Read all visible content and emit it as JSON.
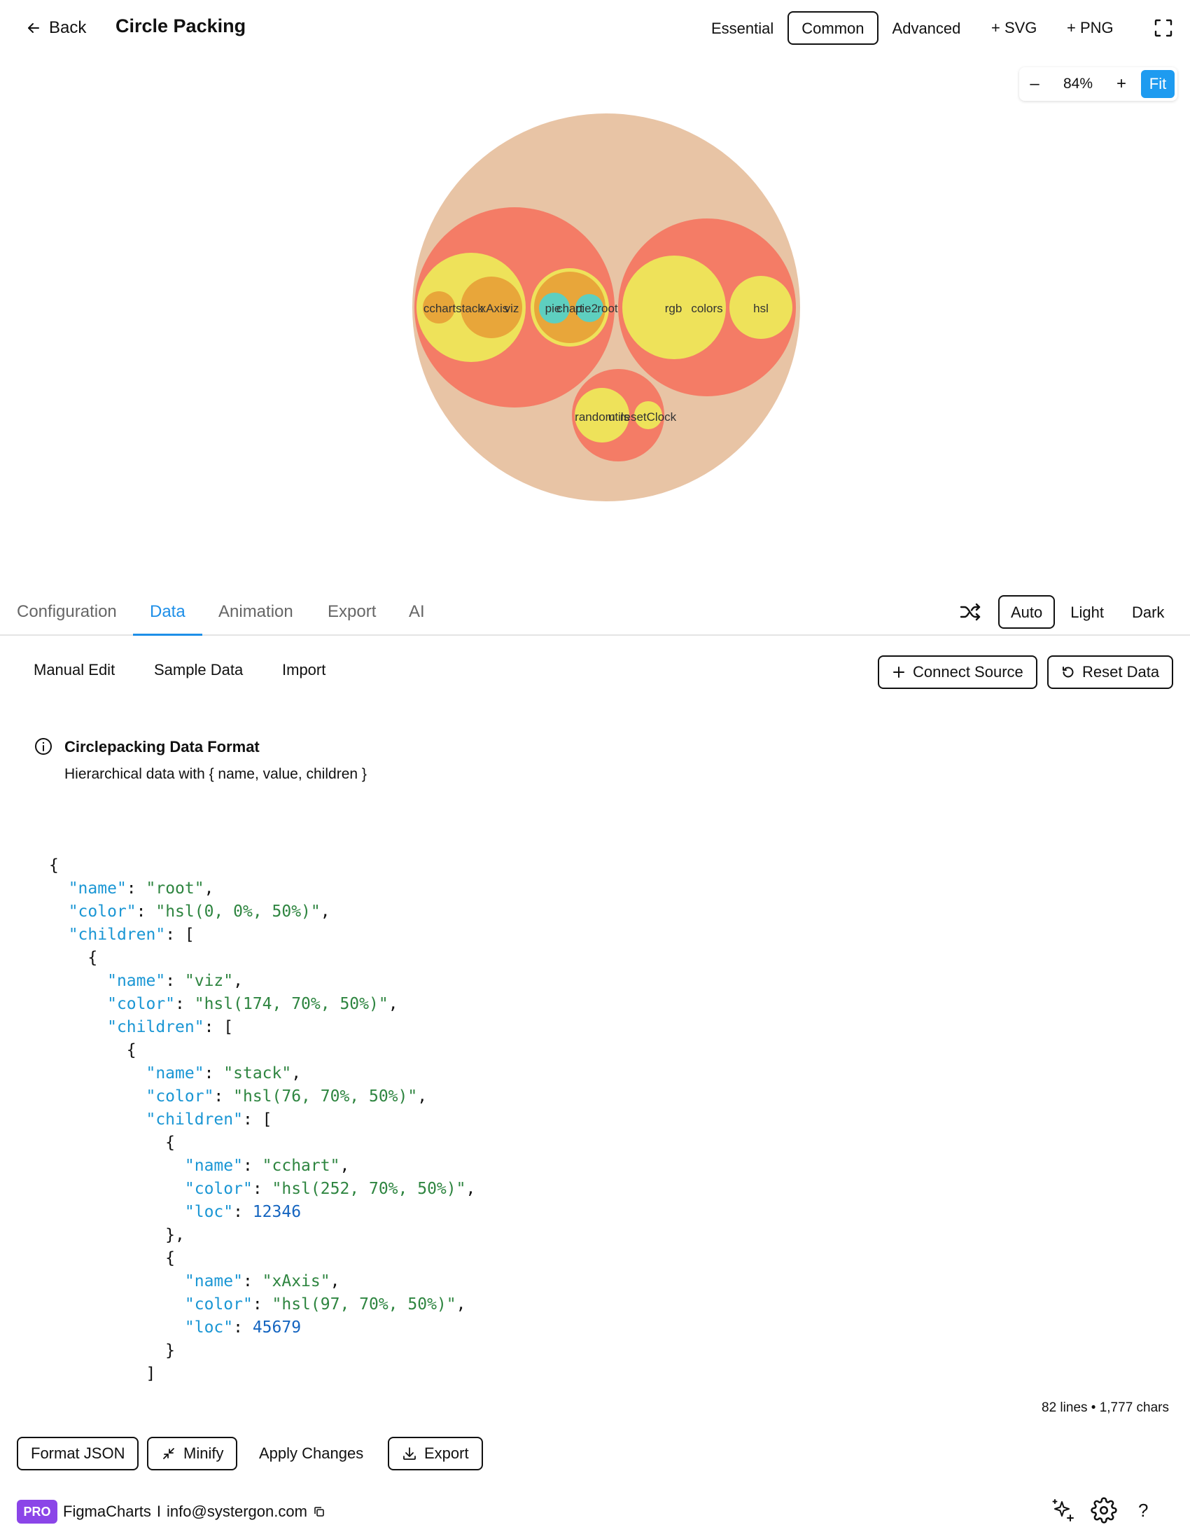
{
  "header": {
    "back_label": "Back",
    "title": "Circle Packing",
    "modes": [
      "Essential",
      "Common",
      "Advanced"
    ],
    "active_mode": "Common",
    "add_svg_label": "+ SVG",
    "add_png_label": "+ PNG"
  },
  "zoom": {
    "minus": "–",
    "value": "84%",
    "plus": "+",
    "fit_label": "Fit",
    "fit_color": "#1e9bf0"
  },
  "chart_data": {
    "type": "circle-packing",
    "colors": {
      "root": "#e8c4a5",
      "group": "#f47c66",
      "leaf": "#eee25a",
      "inner": "#e8a63a",
      "accent": "#5ecfbf"
    },
    "labels": [
      "cchart",
      "stack",
      "xAxis",
      "viz",
      "pie",
      "chart",
      "pie2",
      "root",
      "rgb",
      "colors",
      "hsl",
      "random",
      "utils",
      "resetClock"
    ]
  },
  "tabs": {
    "items": [
      "Configuration",
      "Data",
      "Animation",
      "Export",
      "AI"
    ],
    "active": "Data"
  },
  "theme": {
    "options": [
      "Auto",
      "Light",
      "Dark"
    ],
    "active": "Auto"
  },
  "subtabs": {
    "items": [
      "Manual Edit",
      "Sample Data",
      "Import"
    ]
  },
  "actions": {
    "connect_source": "Connect Source",
    "reset_data": "Reset Data"
  },
  "info": {
    "title": "Circlepacking Data Format",
    "description": "Hierarchical data with { name, value, children }"
  },
  "editor": {
    "lines": [
      [
        [
          "pun",
          "{"
        ]
      ],
      [
        [
          "pun",
          "  "
        ],
        [
          "key",
          "\"name\""
        ],
        [
          "pun",
          ": "
        ],
        [
          "str",
          "\"root\""
        ],
        [
          "pun",
          ","
        ]
      ],
      [
        [
          "pun",
          "  "
        ],
        [
          "key",
          "\"color\""
        ],
        [
          "pun",
          ": "
        ],
        [
          "str",
          "\"hsl(0, 0%, 50%)\""
        ],
        [
          "pun",
          ","
        ]
      ],
      [
        [
          "pun",
          "  "
        ],
        [
          "key",
          "\"children\""
        ],
        [
          "pun",
          ": ["
        ]
      ],
      [
        [
          "pun",
          "    {"
        ]
      ],
      [
        [
          "pun",
          "      "
        ],
        [
          "key",
          "\"name\""
        ],
        [
          "pun",
          ": "
        ],
        [
          "str",
          "\"viz\""
        ],
        [
          "pun",
          ","
        ]
      ],
      [
        [
          "pun",
          "      "
        ],
        [
          "key",
          "\"color\""
        ],
        [
          "pun",
          ": "
        ],
        [
          "str",
          "\"hsl(174, 70%, 50%)\""
        ],
        [
          "pun",
          ","
        ]
      ],
      [
        [
          "pun",
          "      "
        ],
        [
          "key",
          "\"children\""
        ],
        [
          "pun",
          ": ["
        ]
      ],
      [
        [
          "pun",
          "        {"
        ]
      ],
      [
        [
          "pun",
          "          "
        ],
        [
          "key",
          "\"name\""
        ],
        [
          "pun",
          ": "
        ],
        [
          "str",
          "\"stack\""
        ],
        [
          "pun",
          ","
        ]
      ],
      [
        [
          "pun",
          "          "
        ],
        [
          "key",
          "\"color\""
        ],
        [
          "pun",
          ": "
        ],
        [
          "str",
          "\"hsl(76, 70%, 50%)\""
        ],
        [
          "pun",
          ","
        ]
      ],
      [
        [
          "pun",
          "          "
        ],
        [
          "key",
          "\"children\""
        ],
        [
          "pun",
          ": ["
        ]
      ],
      [
        [
          "pun",
          "            {"
        ]
      ],
      [
        [
          "pun",
          "              "
        ],
        [
          "key",
          "\"name\""
        ],
        [
          "pun",
          ": "
        ],
        [
          "str",
          "\"cchart\""
        ],
        [
          "pun",
          ","
        ]
      ],
      [
        [
          "pun",
          "              "
        ],
        [
          "key",
          "\"color\""
        ],
        [
          "pun",
          ": "
        ],
        [
          "str",
          "\"hsl(252, 70%, 50%)\""
        ],
        [
          "pun",
          ","
        ]
      ],
      [
        [
          "pun",
          "              "
        ],
        [
          "key",
          "\"loc\""
        ],
        [
          "pun",
          ": "
        ],
        [
          "num",
          "12346"
        ]
      ],
      [
        [
          "pun",
          "            },"
        ]
      ],
      [
        [
          "pun",
          "            {"
        ]
      ],
      [
        [
          "pun",
          "              "
        ],
        [
          "key",
          "\"name\""
        ],
        [
          "pun",
          ": "
        ],
        [
          "str",
          "\"xAxis\""
        ],
        [
          "pun",
          ","
        ]
      ],
      [
        [
          "pun",
          "              "
        ],
        [
          "key",
          "\"color\""
        ],
        [
          "pun",
          ": "
        ],
        [
          "str",
          "\"hsl(97, 70%, 50%)\""
        ],
        [
          "pun",
          ","
        ]
      ],
      [
        [
          "pun",
          "              "
        ],
        [
          "key",
          "\"loc\""
        ],
        [
          "pun",
          ": "
        ],
        [
          "num",
          "45679"
        ]
      ],
      [
        [
          "pun",
          "            }"
        ]
      ],
      [
        [
          "pun",
          "          ]"
        ]
      ]
    ],
    "stats": "82 lines • 1,777 chars"
  },
  "bottom": {
    "format_json": "Format JSON",
    "minify": "Minify",
    "apply_changes": "Apply Changes",
    "export": "Export"
  },
  "footer": {
    "badge": "PRO",
    "brand": "FigmaCharts",
    "separator": "I",
    "email": "info@systergon.com",
    "help": "?"
  }
}
